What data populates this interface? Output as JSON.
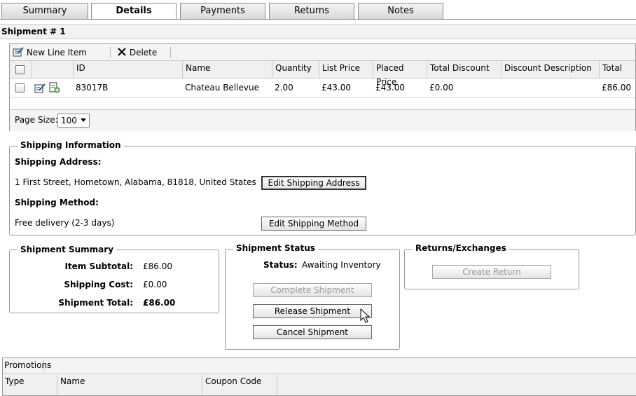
{
  "tabs": [
    {
      "label": "Summary"
    },
    {
      "label": "Details"
    },
    {
      "label": "Payments"
    },
    {
      "label": "Returns"
    },
    {
      "label": "Notes"
    }
  ],
  "shipment": {
    "title": "Shipment # 1"
  },
  "toolbar": {
    "new_line_item": "New Line Item",
    "delete": "Delete"
  },
  "grid": {
    "columns": [
      "ID",
      "Name",
      "Quantity",
      "List Price",
      "Placed Price",
      "Total Discount",
      "Discount Description",
      "Total"
    ],
    "rows": [
      {
        "id": "83017B",
        "name": "Chateau Bellevue",
        "quantity": "2.00",
        "list_price": "£43.00",
        "placed_price": "£43.00",
        "total_discount": "£0.00",
        "discount_description": "",
        "total": "£86.00"
      }
    ],
    "page_size_label": "Page Size:",
    "page_size_value": "100"
  },
  "shipping_info": {
    "legend": "Shipping Information",
    "address_label": "Shipping Address:",
    "address": "1 First Street, Hometown, Alabama, 81818, United States",
    "edit_address_button": "Edit Shipping Address",
    "method_label": "Shipping Method:",
    "method": "Free delivery (2-3 days)",
    "edit_method_button": "Edit Shipping Method"
  },
  "summary": {
    "legend": "Shipment Summary",
    "item_subtotal_label": "Item Subtotal:",
    "item_subtotal": "£86.00",
    "shipping_cost_label": "Shipping Cost:",
    "shipping_cost": "£0.00",
    "total_label": "Shipment Total:",
    "total": "£86.00"
  },
  "status": {
    "legend": "Shipment Status",
    "status_label": "Status:",
    "status_value": "Awaiting Inventory",
    "complete_button": "Complete Shipment",
    "release_button": "Release Shipment",
    "cancel_button": "Cancel Shipment"
  },
  "returns": {
    "legend": "Returns/Exchanges",
    "create_button": "Create Return"
  },
  "promotions": {
    "title": "Promotions",
    "columns": [
      "Type",
      "Name",
      "Coupon Code"
    ]
  }
}
